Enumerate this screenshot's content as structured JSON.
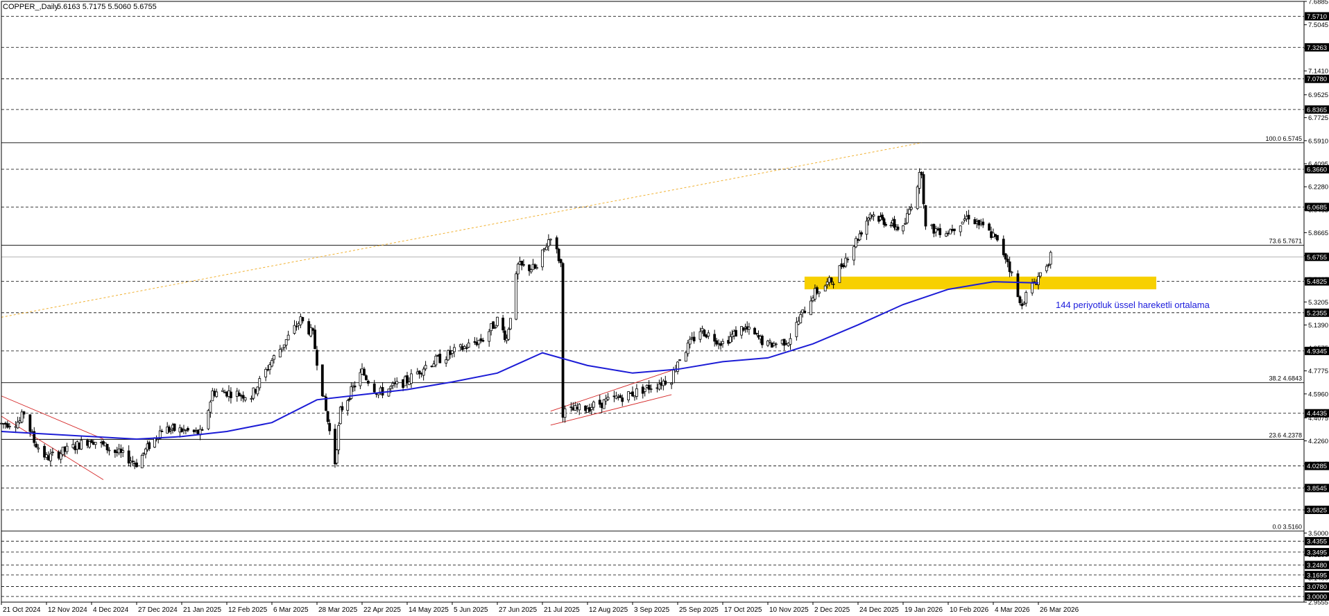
{
  "header": {
    "symbol": "COPPER_,Daily",
    "ohlc": "5.6163 5.7175 5.5060 5.6755"
  },
  "colors": {
    "background": "#ffffff",
    "candle": "#000000",
    "ema": "#1c1cd6",
    "support_zone": "#f7d000",
    "fib_trend": "#f0b030",
    "channel": "#d42424",
    "annotation": "#1a1adc"
  },
  "chart_data": {
    "type": "candlestick",
    "instrument": "COPPER_",
    "timeframe": "Daily",
    "ohlc_last": {
      "open": 5.6163,
      "high": 5.7175,
      "low": 5.506,
      "close": 5.6755
    },
    "ylim": [
      2.9555,
      7.6885
    ],
    "y_ticks": [
      "7.6885",
      "7.5045",
      "7.3205",
      "7.1410",
      "6.9525",
      "6.7725",
      "6.5910",
      "6.4095",
      "6.2280",
      "6.0465",
      "5.8665",
      "5.6850",
      "5.5005",
      "5.3205",
      "5.1390",
      "4.9575",
      "4.7775",
      "4.5960",
      "4.4075",
      "4.2260",
      "4.0445",
      "3.8630",
      "3.6815",
      "3.5000",
      "3.3290",
      "3.1480",
      "2.9555"
    ],
    "price_labels": [
      {
        "value": 7.571,
        "label": "7.5710"
      },
      {
        "value": 7.3263,
        "label": "7.3263"
      },
      {
        "value": 7.078,
        "label": "7.0780"
      },
      {
        "value": 6.8365,
        "label": "6.8365"
      },
      {
        "value": 6.366,
        "label": "6.3660"
      },
      {
        "value": 6.0685,
        "label": "6.0685"
      },
      {
        "value": 5.4825,
        "label": "5.4825"
      },
      {
        "value": 5.2355,
        "label": "5.2355"
      },
      {
        "value": 4.9345,
        "label": "4.9345"
      },
      {
        "value": 4.4435,
        "label": "4.4435"
      },
      {
        "value": 4.0285,
        "label": "4.0285"
      },
      {
        "value": 3.8545,
        "label": "3.8545"
      },
      {
        "value": 3.6825,
        "label": "3.6825"
      },
      {
        "value": 3.4355,
        "label": "3.4355"
      },
      {
        "value": 3.3495,
        "label": "3.3495"
      },
      {
        "value": 3.248,
        "label": "3.2480"
      },
      {
        "value": 3.1695,
        "label": "3.1695"
      },
      {
        "value": 3.078,
        "label": "3.0780"
      },
      {
        "value": 3.0,
        "label": "3.0000"
      }
    ],
    "current_price": {
      "value": 5.6755,
      "label": "5.6755"
    },
    "fibonacci": [
      {
        "level": "100.0",
        "value": 6.5745,
        "label": "100.0 6.5745"
      },
      {
        "level": "73.6",
        "value": 5.7671,
        "label": "73.6 5.7671"
      },
      {
        "level": "38.2",
        "value": 4.6843,
        "label": "38.2 4.6843"
      },
      {
        "level": "23.6",
        "value": 4.2378,
        "label": "23.6 4.2378"
      },
      {
        "level": "0.0",
        "value": 3.516,
        "label": "0.0 3.5160"
      }
    ],
    "x_labels": [
      "21 Oct 2024",
      "12 Nov 2024",
      "4 Dec 2024",
      "27 Dec 2024",
      "21 Jan 2025",
      "12 Feb 2025",
      "6 Mar 2025",
      "28 Mar 2025",
      "22 Apr 2025",
      "14 May 2025",
      "5 Jun 2025",
      "27 Jun 2025",
      "21 Jul 2025",
      "12 Aug 2025",
      "3 Sep 2025",
      "25 Sep 2025",
      "17 Oct 2025",
      "10 Nov 2025",
      "2 Dec 2025",
      "24 Dec 2025",
      "19 Jan 2026",
      "10 Feb 2026",
      "4 Mar 2026",
      "26 Mar 2026"
    ],
    "price_path": [
      [
        "21 Oct 2024",
        4.36
      ],
      [
        "30 Oct 2024",
        4.38
      ],
      [
        "1 Nov 2024",
        4.45
      ],
      [
        "6 Nov 2024",
        4.22
      ],
      [
        "12 Nov 2024",
        4.09
      ],
      [
        "20 Nov 2024",
        4.14
      ],
      [
        "4 Dec 2024",
        4.24
      ],
      [
        "12 Dec 2024",
        4.17
      ],
      [
        "20 Dec 2024",
        4.11
      ],
      [
        "27 Dec 2024",
        4.05
      ],
      [
        "3 Jan 2025",
        4.19
      ],
      [
        "10 Jan 2025",
        4.32
      ],
      [
        "21 Jan 2025",
        4.31
      ],
      [
        "31 Jan 2025",
        4.28
      ],
      [
        "5 Feb 2025",
        4.61
      ],
      [
        "12 Feb 2025",
        4.61
      ],
      [
        "24 Feb 2025",
        4.58
      ],
      [
        "6 Mar 2025",
        4.86
      ],
      [
        "20 Mar 2025",
        5.18
      ],
      [
        "26 Mar 2025",
        5.06
      ],
      [
        "28 Mar 2025",
        4.86
      ],
      [
        "7 Apr 2025",
        4.06
      ],
      [
        "10 Apr 2025",
        4.46
      ],
      [
        "22 Apr 2025",
        4.77
      ],
      [
        "30 Apr 2025",
        4.6
      ],
      [
        "14 May 2025",
        4.7
      ],
      [
        "23 May 2025",
        4.82
      ],
      [
        "5 Jun 2025",
        4.92
      ],
      [
        "20 Jun 2025",
        5.03
      ],
      [
        "27 Jun 2025",
        5.18
      ],
      [
        "2 Jul 2025",
        5.03
      ],
      [
        "8 Jul 2025",
        5.6
      ],
      [
        "18 Jul 2025",
        5.58
      ],
      [
        "25 Jul 2025",
        5.85
      ],
      [
        "30 Jul 2025",
        5.62
      ],
      [
        "31 Jul 2025",
        4.45
      ],
      [
        "12 Aug 2025",
        4.49
      ],
      [
        "3 Sep 2025",
        4.6
      ],
      [
        "22 Sep 2025",
        4.72
      ],
      [
        "25 Sep 2025",
        4.86
      ],
      [
        "6 Oct 2025",
        5.1
      ],
      [
        "17 Oct 2025",
        5.0
      ],
      [
        "28 Oct 2025",
        5.12
      ],
      [
        "10 Nov 2025",
        4.98
      ],
      [
        "20 Nov 2025",
        5.02
      ],
      [
        "2 Dec 2025",
        5.38
      ],
      [
        "12 Dec 2025",
        5.5
      ],
      [
        "24 Dec 2025",
        5.83
      ],
      [
        "31 Dec 2025",
        6.02
      ],
      [
        "8 Jan 2026",
        5.96
      ],
      [
        "19 Jan 2026",
        5.89
      ],
      [
        "28 Jan 2026",
        6.36
      ],
      [
        "30 Jan 2026",
        5.9
      ],
      [
        "10 Feb 2026",
        5.88
      ],
      [
        "20 Feb 2026",
        6.0
      ],
      [
        "4 Mar 2026",
        5.84
      ],
      [
        "11 Mar 2026",
        5.65
      ],
      [
        "17 Mar 2026",
        5.3
      ],
      [
        "26 Mar 2026",
        5.52
      ],
      [
        "1 Apr 2026",
        5.6755
      ]
    ],
    "ema_path": [
      [
        "21 Oct 2024",
        4.3
      ],
      [
        "27 Dec 2024",
        4.24
      ],
      [
        "21 Jan 2025",
        4.26
      ],
      [
        "12 Feb 2025",
        4.3
      ],
      [
        "6 Mar 2025",
        4.37
      ],
      [
        "28 Mar 2025",
        4.55
      ],
      [
        "22 Apr 2025",
        4.59
      ],
      [
        "14 May 2025",
        4.63
      ],
      [
        "5 Jun 2025",
        4.69
      ],
      [
        "27 Jun 2025",
        4.76
      ],
      [
        "21 Jul 2025",
        4.92
      ],
      [
        "12 Aug 2025",
        4.82
      ],
      [
        "3 Sep 2025",
        4.76
      ],
      [
        "25 Sep 2025",
        4.79
      ],
      [
        "17 Oct 2025",
        4.85
      ],
      [
        "10 Nov 2025",
        4.88
      ],
      [
        "2 Dec 2025",
        4.99
      ],
      [
        "24 Dec 2025",
        5.14
      ],
      [
        "19 Jan 2026",
        5.3
      ],
      [
        "10 Feb 2026",
        5.42
      ],
      [
        "4 Mar 2026",
        5.48
      ],
      [
        "26 Mar 2026",
        5.47
      ]
    ],
    "support_zone": {
      "low": 5.42,
      "high": 5.52,
      "from": "4 Dec 2025"
    },
    "annotation": "144 periyotluk üssel hareketli ortalama",
    "grid": "dashed horizontal lines at price levels",
    "legend": "none"
  }
}
